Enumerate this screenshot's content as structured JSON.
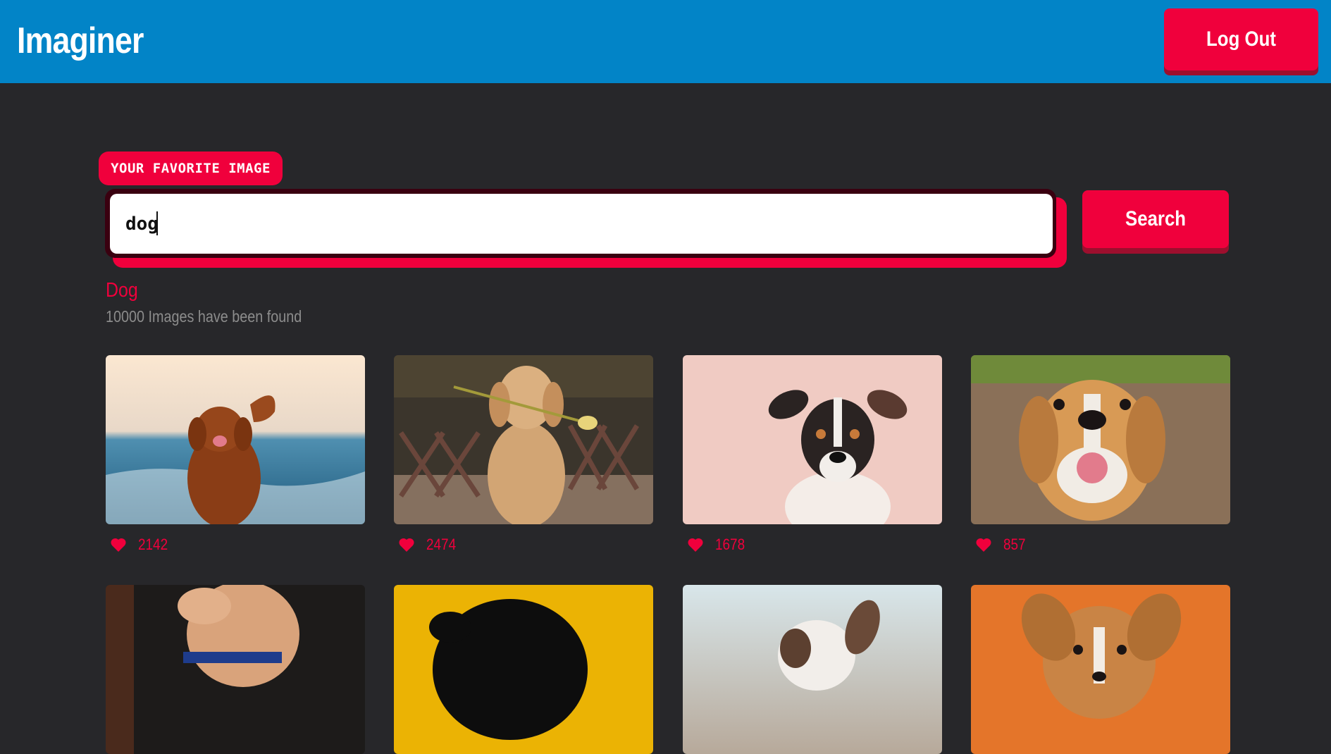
{
  "header": {
    "app_title": "Imaginer",
    "logout_label": "Log Out"
  },
  "search": {
    "field_label": "YOUR FAVORITE IMAGE",
    "value": "dog",
    "button_label": "Search"
  },
  "results": {
    "title": "Dog",
    "count_text": "10000 Images have been found",
    "cards": [
      {
        "likes": "2142",
        "palette": {
          "bg_top": "#fbe7d1",
          "bg_bottom": "#2f6f93",
          "subject": "#8a3d16"
        }
      },
      {
        "likes": "2474",
        "palette": {
          "bg_top": "#3b352c",
          "bg_bottom": "#85705f",
          "subject": "#d2a574"
        }
      },
      {
        "likes": "1678",
        "palette": {
          "bg_top": "#f0cbc3",
          "bg_bottom": "#e9b9b1",
          "subject": "#2a2322"
        }
      },
      {
        "likes": "857",
        "palette": {
          "bg_top": "#6f8a3a",
          "bg_bottom": "#8a7058",
          "subject": "#d89a55"
        }
      },
      {
        "likes": "",
        "palette": {
          "bg_top": "#1d1b1a",
          "bg_bottom": "#3a2a22",
          "subject": "#d9a37b"
        }
      },
      {
        "likes": "",
        "palette": {
          "bg_top": "#ebb304",
          "bg_bottom": "#ebb304",
          "subject": "#0d0d0d"
        }
      },
      {
        "likes": "",
        "palette": {
          "bg_top": "#d8e6ea",
          "bg_bottom": "#b7a99a",
          "subject": "#5c4030"
        }
      },
      {
        "likes": "",
        "palette": {
          "bg_top": "#e4752a",
          "bg_bottom": "#de6a24",
          "subject": "#c98445"
        }
      }
    ]
  },
  "colors": {
    "header": "#0284c7",
    "accent": "#f0003c",
    "background": "#27272a"
  }
}
